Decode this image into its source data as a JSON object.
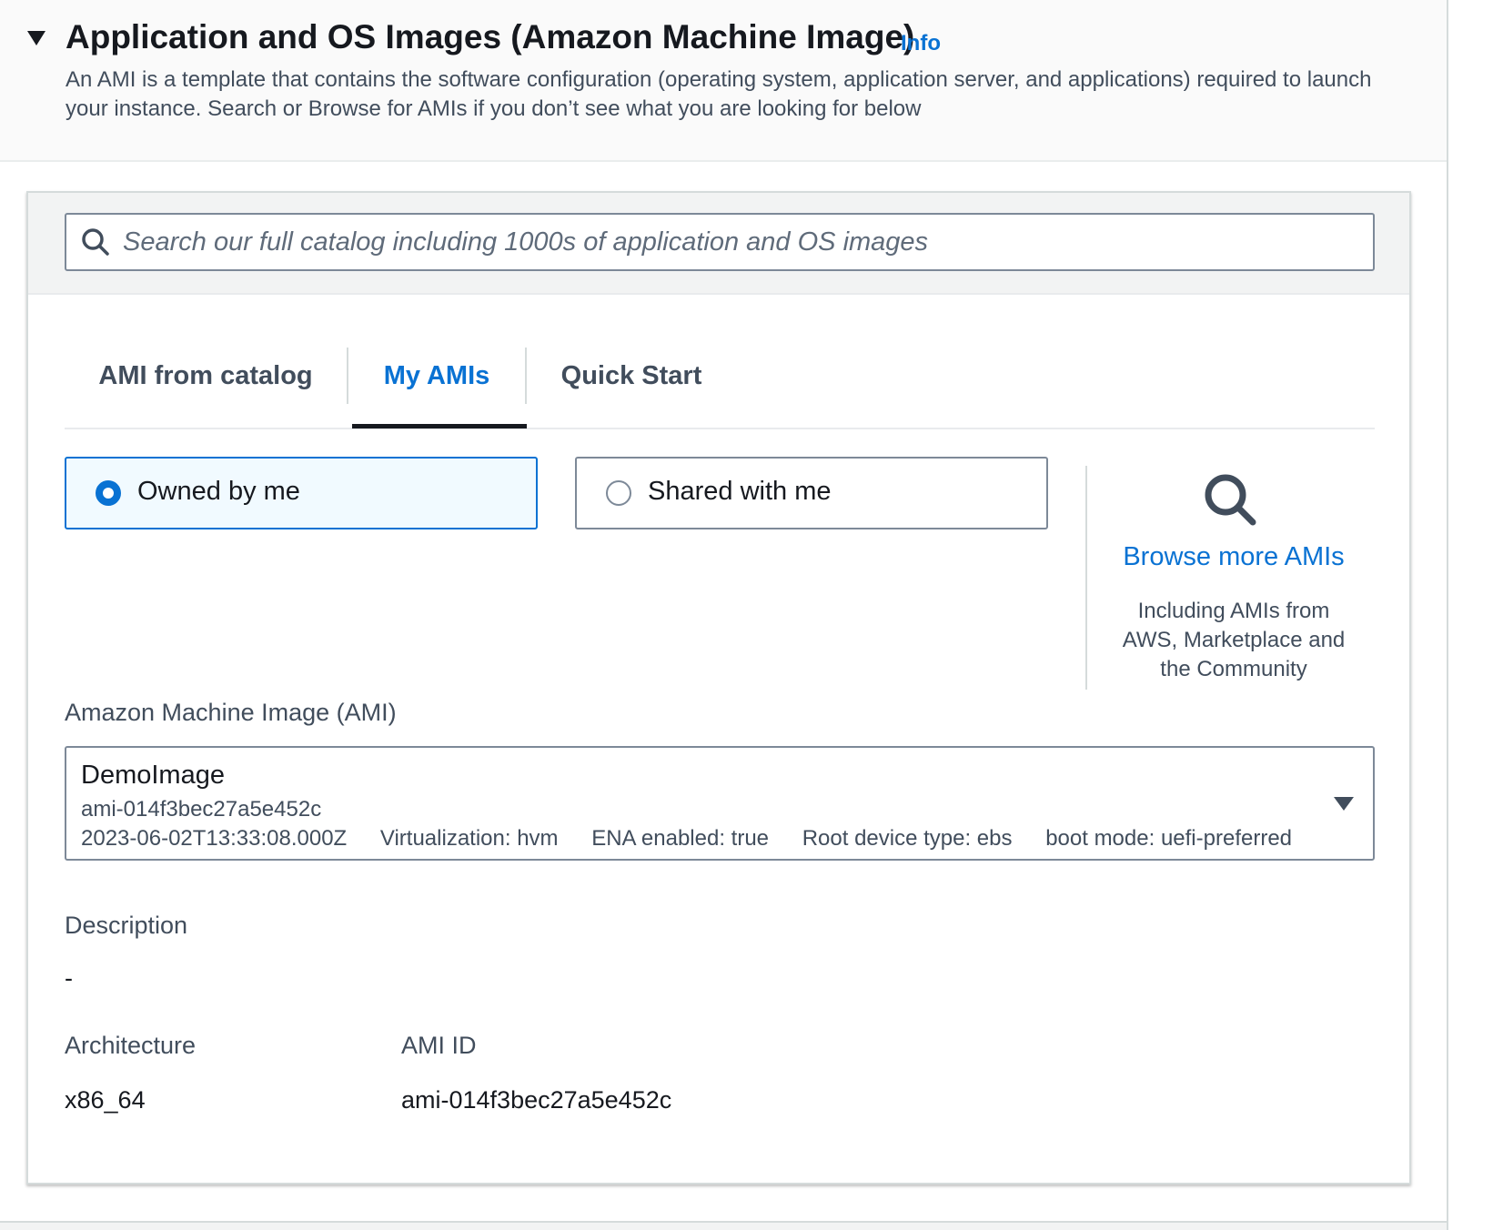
{
  "header": {
    "title": "Application and OS Images (Amazon Machine Image)",
    "info_link": "Info",
    "description": "An AMI is a template that contains the software configuration (operating system, application server, and applications) required to launch your instance. Search or Browse for AMIs if you don’t see what you are looking for below",
    "collapse_icon": "caret-down-icon"
  },
  "search": {
    "placeholder": "Search our full catalog including 1000s of application and OS images",
    "icon": "search-icon"
  },
  "tabs": [
    {
      "label": "AMI from catalog",
      "active": false
    },
    {
      "label": "My AMIs",
      "active": true
    },
    {
      "label": "Quick Start",
      "active": false
    }
  ],
  "ownership": {
    "options": [
      {
        "label": "Owned by me",
        "selected": true
      },
      {
        "label": "Shared with me",
        "selected": false
      }
    ]
  },
  "browse": {
    "icon": "search-icon",
    "link": "Browse more AMIs",
    "description": "Including AMIs from AWS, Marketplace and the Community"
  },
  "ami": {
    "label": "Amazon Machine Image (AMI)",
    "selected": {
      "name": "DemoImage",
      "id": "ami-014f3bec27a5e452c",
      "created": "2023-06-02T13:33:08.000Z",
      "virtualization": "Virtualization: hvm",
      "ena": "ENA enabled: true",
      "root_device": "Root device type: ebs",
      "boot_mode": "boot mode: uefi-preferred"
    }
  },
  "details": {
    "description_label": "Description",
    "description_value": "-",
    "architecture_label": "Architecture",
    "architecture_value": "x86_64",
    "ami_id_label": "AMI ID",
    "ami_id_value": "ami-014f3bec27a5e452c"
  },
  "colors": {
    "accent": "#0972d3",
    "text": "#16191f",
    "secondary_text": "#414d5c",
    "border": "#7d8998",
    "selected_tile_bg": "#f1faff"
  }
}
